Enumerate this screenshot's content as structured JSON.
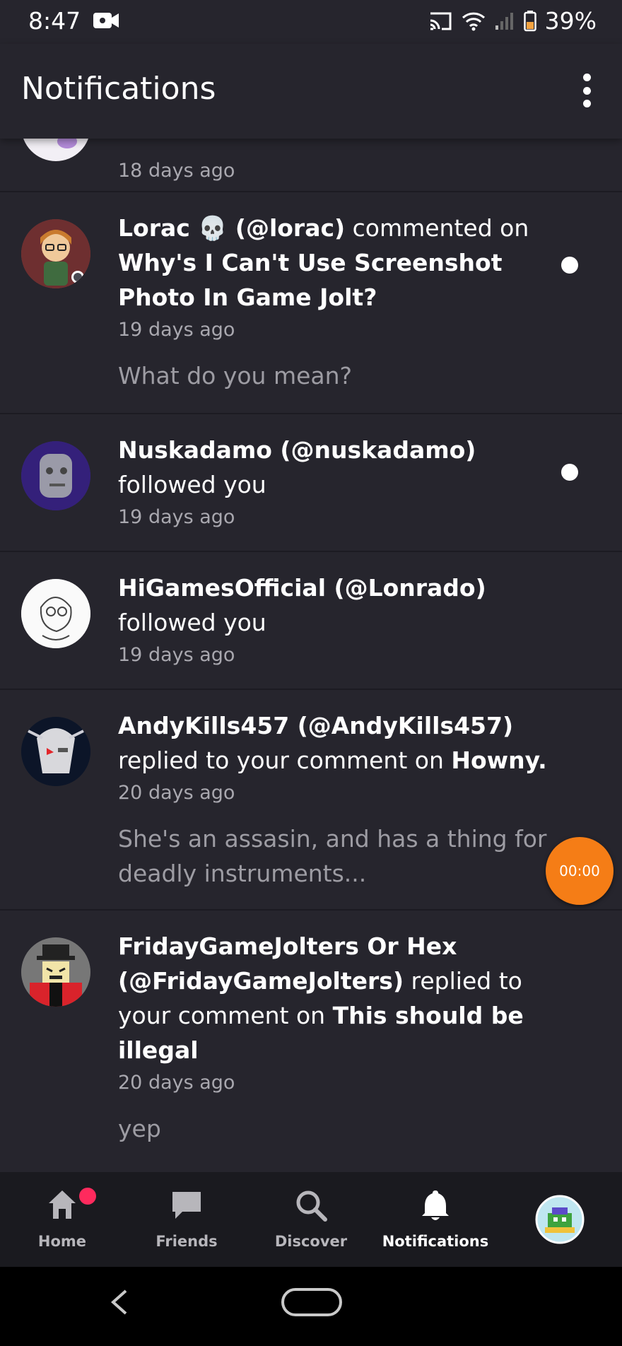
{
  "status": {
    "time": "8:47",
    "battery": "39%"
  },
  "appbar": {
    "title": "Notifications"
  },
  "notifications": [
    {
      "time": "18 days ago"
    },
    {
      "actor": "Lorac 💀 (@lorac)",
      "action": " commented on ",
      "target": "Why's I Can't Use Screenshot Photo In Game Jolt?",
      "time": "19 days ago",
      "snippet": "What do you mean?",
      "unread": true
    },
    {
      "actor": "Nuskadamo (@nuskadamo)",
      "action": " followed you",
      "time": "19 days ago",
      "unread": true
    },
    {
      "actor": "HiGamesOfficial (@Lonrado)",
      "action": " followed you",
      "time": "19 days ago"
    },
    {
      "actor": "AndyKills457 (@AndyKills457)",
      "action": " replied to your comment on ",
      "target": "Howny.",
      "time": "20 days ago",
      "snippet": "She's an assasin, and has a thing for deadly instruments..."
    },
    {
      "actor": "FridayGameJolters Or Hex (@FridayGameJolters)",
      "action": " replied to your comment on ",
      "target": "This should be illegal",
      "time": "20 days ago",
      "snippet": "yep"
    }
  ],
  "timer": "00:00",
  "nav": {
    "home": "Home",
    "friends": "Friends",
    "discover": "Discover",
    "notifications": "Notifications"
  },
  "colors": {
    "background": "#26252d",
    "accent": "#f57d16",
    "badge": "#ff2a5d"
  }
}
